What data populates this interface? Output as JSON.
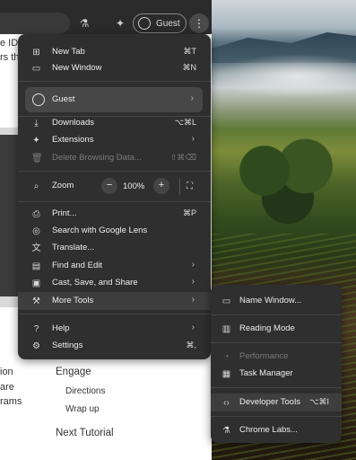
{
  "toolbar": {
    "guest_label": "Guest",
    "labs_icon": "flask-icon",
    "extension_icon": "puzzle-icon",
    "menu_icon": "kebab-icon"
  },
  "page_fragments": {
    "frag1": "e ID",
    "frag2": "rs th",
    "frag3": "ion",
    "frag4": "are",
    "frag5": "rams",
    "engage": "Engage",
    "directions": "Directions",
    "wrap_up": "Wrap up",
    "next_tutorial": "Next Tutorial"
  },
  "menu": {
    "new_tab": {
      "label": "New Tab",
      "shortcut": "⌘T"
    },
    "new_window": {
      "label": "New Window",
      "shortcut": "⌘N"
    },
    "guest": {
      "label": "Guest"
    },
    "downloads": {
      "label": "Downloads",
      "shortcut": "⌥⌘L"
    },
    "extensions": {
      "label": "Extensions"
    },
    "delete_browsing": {
      "label": "Delete Browsing Data...",
      "shortcut": "⇧⌘⌫"
    },
    "zoom": {
      "label": "Zoom",
      "minus": "−",
      "value": "100%",
      "plus": "+"
    },
    "print": {
      "label": "Print...",
      "shortcut": "⌘P"
    },
    "search_lens": {
      "label": "Search with Google Lens"
    },
    "translate": {
      "label": "Translate..."
    },
    "find_edit": {
      "label": "Find and Edit"
    },
    "cast_save": {
      "label": "Cast, Save, and Share"
    },
    "more_tools": {
      "label": "More Tools"
    },
    "help": {
      "label": "Help"
    },
    "settings": {
      "label": "Settings",
      "shortcut": "⌘,"
    }
  },
  "submenu": {
    "name_window": {
      "label": "Name Window..."
    },
    "reading_mode": {
      "label": "Reading Mode"
    },
    "performance": {
      "label": "Performance"
    },
    "task_manager": {
      "label": "Task Manager"
    },
    "developer_tools": {
      "label": "Developer Tools",
      "shortcut": "⌥⌘I"
    },
    "chrome_labs": {
      "label": "Chrome Labs..."
    }
  },
  "colors": {
    "menu_bg": "#2f2f2f",
    "highlight": "#3e3e3e",
    "text": "#ededed",
    "disabled": "#7a7a7a"
  }
}
